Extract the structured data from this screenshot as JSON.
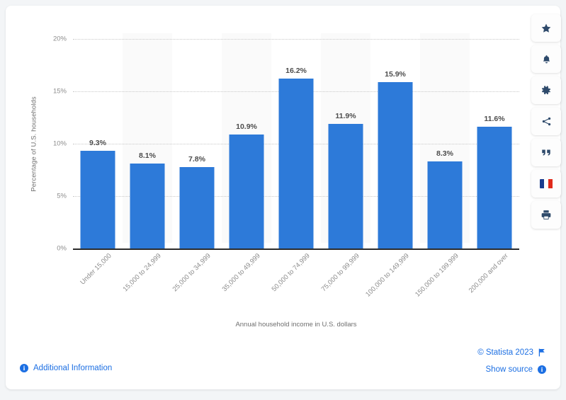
{
  "chart_data": {
    "type": "bar",
    "title": "",
    "xlabel": "Annual household income in U.S. dollars",
    "ylabel": "Percentage of U.S. households",
    "categories": [
      "Under 15,000",
      "15,000 to 24,999",
      "25,000 to 34,999",
      "35,000 to 49,999",
      "50,000 to 74,999",
      "75,000 to 99,999",
      "100,000 to 149,999",
      "150,000 to 199,999",
      "200,000 and over"
    ],
    "values": [
      9.3,
      8.1,
      7.8,
      10.9,
      16.2,
      11.9,
      15.9,
      8.3,
      11.6
    ],
    "value_labels": [
      "9.3%",
      "8.1%",
      "7.8%",
      "10.9%",
      "16.2%",
      "11.9%",
      "15.9%",
      "8.3%",
      "11.6%"
    ],
    "ylim": [
      0,
      20
    ],
    "yticks": [
      0,
      5,
      10,
      15,
      20
    ],
    "ytick_labels": [
      "0%",
      "5%",
      "10%",
      "15%",
      "20%"
    ],
    "grid": true,
    "legend": "none",
    "bar_color": "#2d7ad9",
    "band_color": "#fafafa"
  },
  "footer": {
    "additional_information": "Additional Information",
    "copyright": "© Statista 2023",
    "show_source": "Show source"
  },
  "rail": {
    "items": [
      {
        "name": "favorite-star-icon",
        "label": "Favorite"
      },
      {
        "name": "notification-bell-icon",
        "label": "Notifications"
      },
      {
        "name": "settings-gear-icon",
        "label": "Settings"
      },
      {
        "name": "share-icon",
        "label": "Share"
      },
      {
        "name": "citation-quote-icon",
        "label": "Cite"
      },
      {
        "name": "french-flag-icon",
        "label": "French"
      },
      {
        "name": "print-icon",
        "label": "Print"
      }
    ]
  },
  "colors": {
    "accent": "#1c6fe3",
    "bar": "#2d7ad9",
    "page_background": "#f3f5f7",
    "card": "#ffffff",
    "axis": "#2b2b2b",
    "tick_text": "#8d8d8d"
  }
}
